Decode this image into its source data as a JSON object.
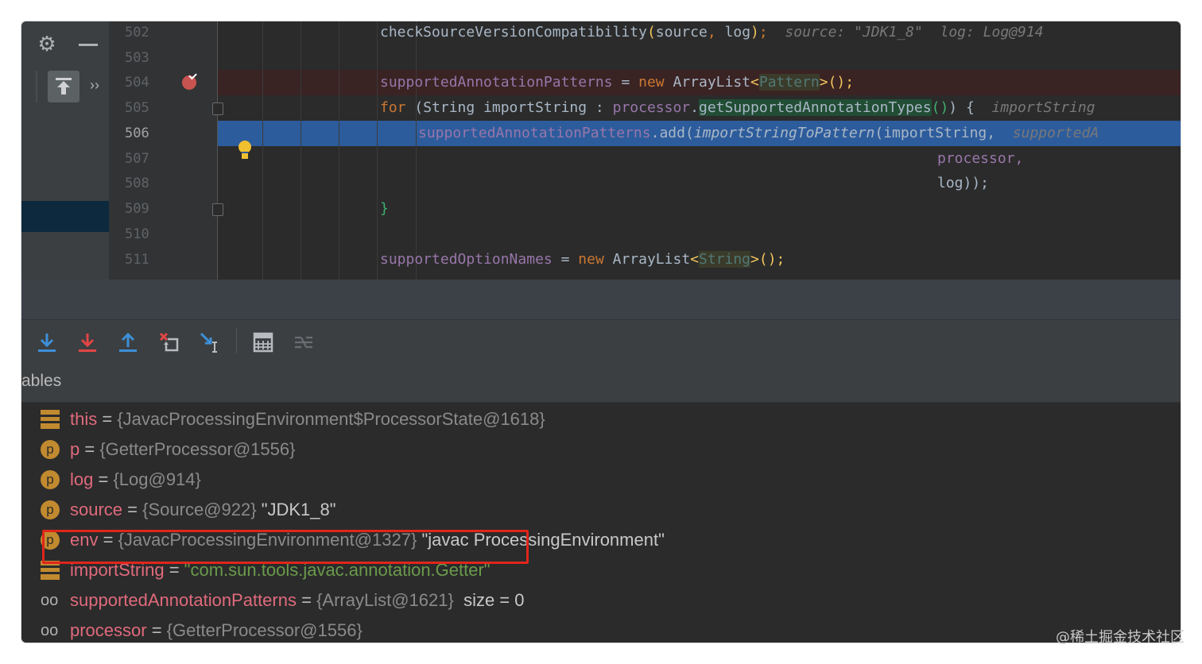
{
  "gutter": {
    "line_numbers": [
      "502",
      "503",
      "504",
      "505",
      "506",
      "507",
      "508",
      "509",
      "510",
      "511"
    ]
  },
  "code": {
    "l502": {
      "text": "checkSourceVersionCompatibility",
      "paren_open": "(",
      "arg1": "source",
      "comma": ", ",
      "arg2": "log",
      "paren_close": ")",
      "semi": ";",
      "hint1": "source: \"JDK1_8\"",
      "hint2": "log: Log@914"
    },
    "l504": {
      "field": "supportedAnnotationPatterns",
      "eq": " = ",
      "kw_new": "new",
      "type": " ArrayList",
      "gen_open": "<",
      "gen": "Pattern",
      "gen_close": ">",
      "tail": "();"
    },
    "l505": {
      "kw_for": "for",
      "open": " (String importString : ",
      "field": "processor",
      "dot": ".",
      "method": "getSupportedAnnotationTypes",
      "call": "()",
      "close": ") {",
      "hint": "importString"
    },
    "l506": {
      "field": "supportedAnnotationPatterns",
      "add": ".add(",
      "method": "importStringToPattern",
      "args": "(importString,",
      "hint": "supportedA"
    },
    "l507": {
      "text": "processor,"
    },
    "l508": {
      "text": "log));"
    },
    "l509": {
      "text": "}"
    },
    "l511": {
      "field": "supportedOptionNames",
      "eq": " = ",
      "kw_new": "new",
      "type": " ArrayList",
      "gen_open": "<",
      "gen": "String",
      "gen_close": ">",
      "tail": "();"
    }
  },
  "variables_panel": {
    "title": "ables",
    "items": [
      {
        "icon": "list-icon",
        "name": "this",
        "eq": " = ",
        "value": "{JavacProcessingEnvironment$ProcessorState@1618}",
        "extra": ""
      },
      {
        "icon": "parameter-icon",
        "icon_letter": "p",
        "name": "p",
        "eq": " = ",
        "value": "{GetterProcessor@1556}",
        "extra": ""
      },
      {
        "icon": "parameter-icon",
        "icon_letter": "p",
        "name": "log",
        "eq": " = ",
        "value": "{Log@914}",
        "extra": ""
      },
      {
        "icon": "parameter-icon",
        "icon_letter": "p",
        "name": "source",
        "eq": " = ",
        "value": "{Source@922}",
        "extra": " \"JDK1_8\""
      },
      {
        "icon": "parameter-icon",
        "icon_letter": "p",
        "name": "env",
        "eq": " = ",
        "value": "{JavacProcessingEnvironment@1327}",
        "extra": " \"javac ProcessingEnvironment\""
      },
      {
        "icon": "list-icon",
        "name": "importString",
        "eq": " = ",
        "value": "\"com.sun.tools.javac.annotation.Getter\"",
        "extra": ""
      },
      {
        "icon": "watch-icon",
        "name": "supportedAnnotationPatterns",
        "eq": " = ",
        "value": "{ArrayList@1621}",
        "extra": "  size = 0"
      },
      {
        "icon": "watch-icon",
        "name": "processor",
        "eq": " = ",
        "value": "{GetterProcessor@1556}",
        "extra": ""
      }
    ]
  },
  "watermark": "@稀土掘金技术社区",
  "colors": {
    "editor_bg": "#2b2b2b",
    "exec_line": "#2d5c9c",
    "breakpoint": "#c75450",
    "var_name": "#e06a7c",
    "string_value": "#6a9a4a",
    "highlight_box": "#e0261b"
  }
}
